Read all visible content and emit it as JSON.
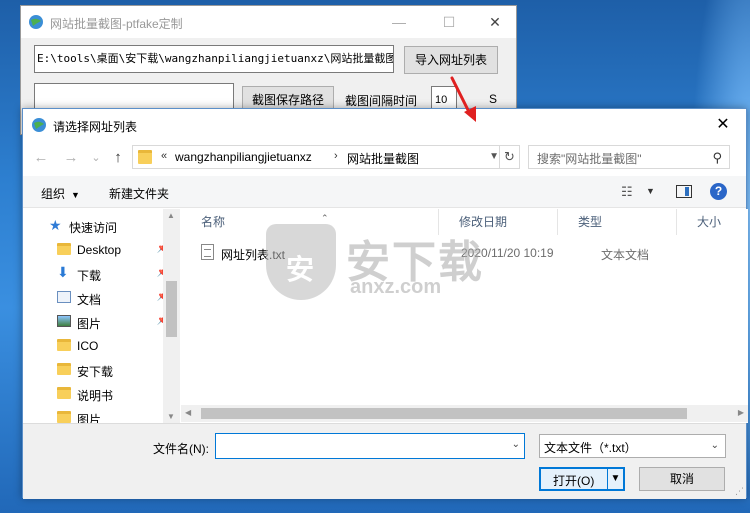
{
  "main_window": {
    "title": "网站批量截图-ptfake定制",
    "path_value": "E:\\tools\\桌面\\安下载\\wangzhanpiliangjietuanxz\\网站批量截图\\",
    "import_button": "导入网址列表",
    "save_path_button": "截图保存路径",
    "interval_label": "截图间隔时间",
    "interval_value": "10",
    "interval_unit": "S",
    "minimize": "—",
    "maximize": "☐",
    "close": "✕"
  },
  "dialog": {
    "title": "请选择网址列表",
    "close": "✕",
    "nav": {
      "back": "←",
      "forward": "→",
      "recent": "⌄",
      "up": "↑"
    },
    "breadcrumb": {
      "overflow": "«",
      "segments": [
        "wangzhanpiliangjietuanxz",
        "网站批量截图"
      ],
      "separator": "›"
    },
    "search_placeholder": "搜索\"网站批量截图\"",
    "toolbar": {
      "organize": "组织",
      "new_folder": "新建文件夹"
    },
    "nav_pane": {
      "quick_access": "快速访问",
      "items": [
        {
          "label": "Desktop",
          "icon": "folder-icon",
          "pinned": true
        },
        {
          "label": "下载",
          "icon": "download-icon",
          "pinned": true
        },
        {
          "label": "文档",
          "icon": "document-icon",
          "pinned": true
        },
        {
          "label": "图片",
          "icon": "picture-icon",
          "pinned": true
        },
        {
          "label": "ICO",
          "icon": "folder-icon",
          "pinned": false
        },
        {
          "label": "安下载",
          "icon": "folder-icon",
          "pinned": false
        },
        {
          "label": "说明书",
          "icon": "folder-icon",
          "pinned": false
        },
        {
          "label": "图片",
          "icon": "folder-icon",
          "pinned": false
        }
      ]
    },
    "columns": [
      "名称",
      "修改日期",
      "类型",
      "大小"
    ],
    "files": [
      {
        "name": "网址列表.txt",
        "modified": "2020/11/20 10:19",
        "type": "文本文档"
      }
    ],
    "filename_label": "文件名(N):",
    "filename_value": "",
    "filetype_value": "文本文件（*.txt）",
    "open_button": "打开(O)",
    "cancel_button": "取消"
  },
  "watermark": {
    "cn": "安下载",
    "en": "anxz.com",
    "shield": "安"
  },
  "colors": {
    "accent": "#0078d7",
    "arrow": "#e02020",
    "folder": "#f8cf5a"
  }
}
